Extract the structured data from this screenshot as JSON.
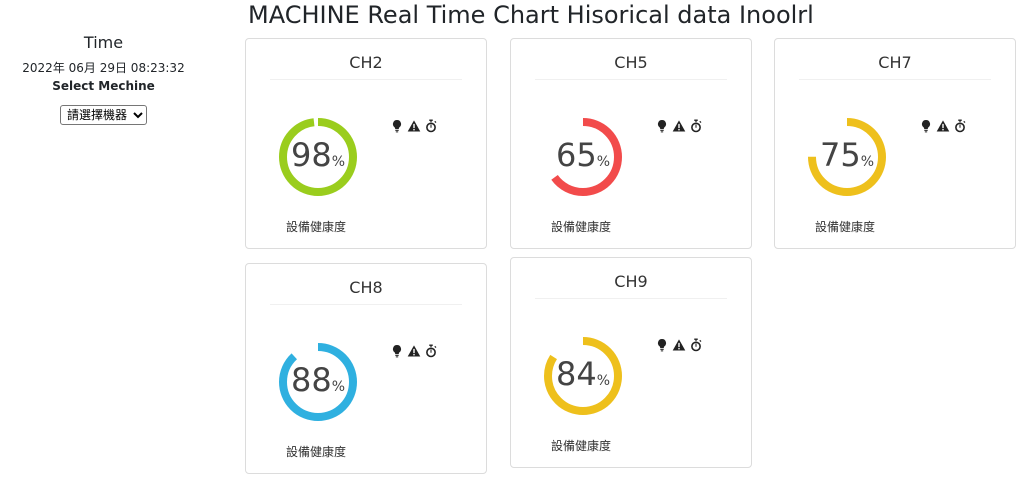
{
  "header": {
    "title": "MACHINE Real Time Chart Hisorical data Inoolrl"
  },
  "sidebar": {
    "time_label": "Time",
    "time_value": "2022年 06月 29日 08:23:32",
    "select_label": "Select Mechine",
    "select_value": "請選擇機器"
  },
  "cards": [
    {
      "title": "CH2",
      "value": "98",
      "percent_sign": "%",
      "level": 0.98,
      "color": "#9acd1d",
      "label": "設備健康度"
    },
    {
      "title": "CH5",
      "value": "65",
      "percent_sign": "%",
      "level": 0.65,
      "color": "#f24b4b",
      "label": "設備健康度"
    },
    {
      "title": "CH7",
      "value": "75",
      "percent_sign": "%",
      "level": 0.75,
      "color": "#eec01c",
      "label": "設備健康度"
    },
    {
      "title": "CH8",
      "value": "88",
      "percent_sign": "%",
      "level": 0.88,
      "color": "#2fb0e0",
      "label": "設備健康度"
    },
    {
      "title": "CH9",
      "value": "84",
      "percent_sign": "%",
      "level": 0.84,
      "color": "#eec01c",
      "label": "設備健康度"
    }
  ],
  "icons": [
    "lightbulb-icon",
    "warning-icon",
    "stopwatch-icon"
  ]
}
